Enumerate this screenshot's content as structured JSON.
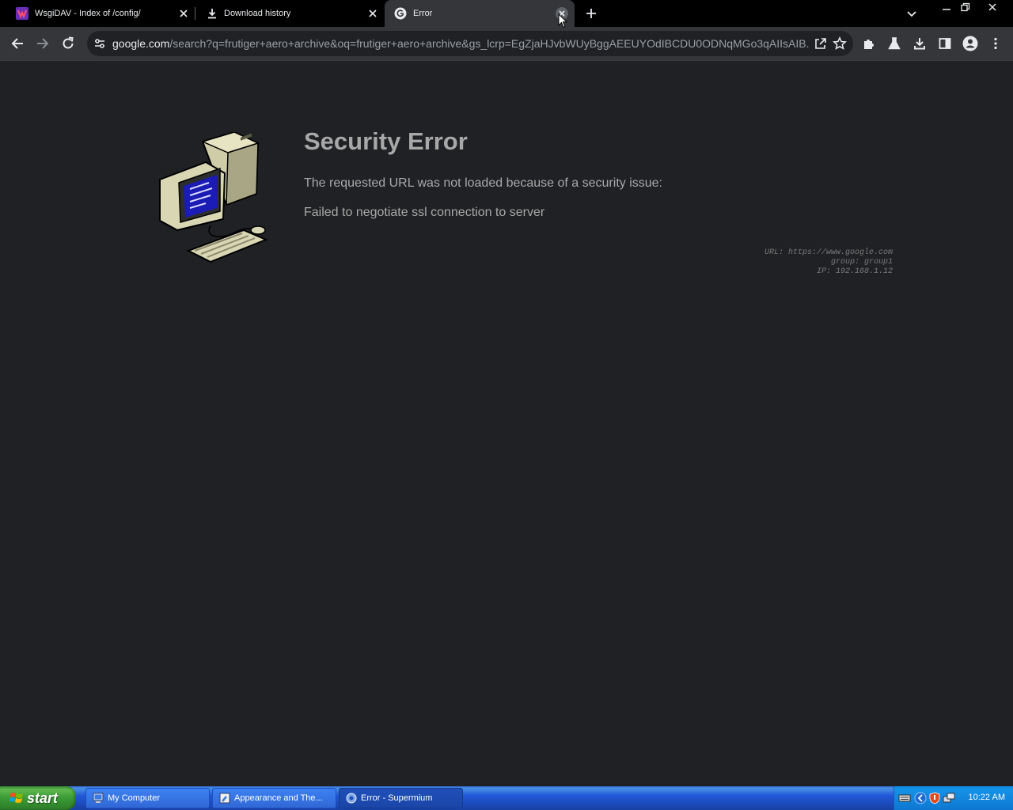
{
  "browser": {
    "tabs": [
      {
        "title": "WsgiDAV - Index of /config/",
        "icon": "wsgidav-favicon"
      },
      {
        "title": "Download history",
        "icon": "download-icon"
      },
      {
        "title": "Error",
        "icon": "google-g-icon",
        "active": true
      }
    ],
    "address": {
      "host": "google.com",
      "path": "/search?q=frutiger+aero+archive&oq=frutiger+aero+archive&gs_lcrp=EgZjaHJvbWUyBggAEEUYOdIBCDU0ODNqMGo3qAIIsAIB..."
    }
  },
  "page": {
    "title": "Security Error",
    "description": "The requested URL was not loaded because of a security issue:",
    "detail": "Failed to negotiate ssl connection to server",
    "meta": {
      "url": "URL: https://www.google.com",
      "group": "group: group1",
      "ip": "IP: 192.168.1.12"
    }
  },
  "taskbar": {
    "start_label": "start",
    "tasks": [
      {
        "label": "My Computer",
        "icon": "my-computer-icon"
      },
      {
        "label": "Appearance and The...",
        "icon": "control-panel-icon"
      },
      {
        "label": "Error - Supermium",
        "icon": "browser-icon",
        "active": true
      }
    ],
    "clock": "10:22 AM"
  }
}
